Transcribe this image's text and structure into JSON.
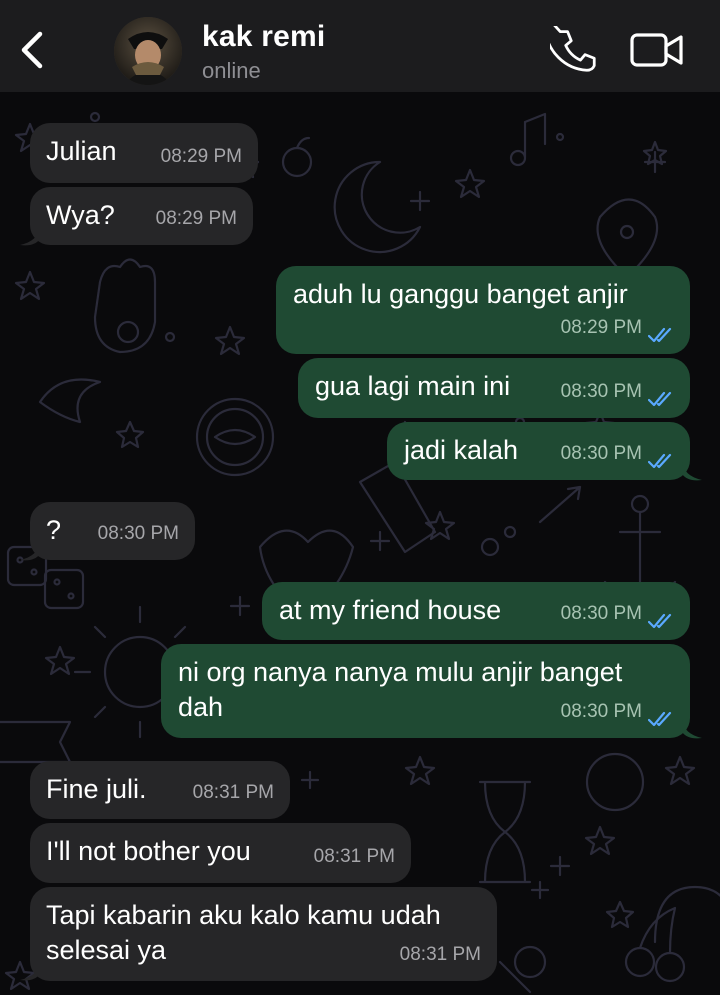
{
  "header": {
    "contact_name": "kak remi",
    "status": "online",
    "icons": {
      "back": "chevron-left-icon",
      "call": "phone-icon",
      "video": "video-camera-icon"
    }
  },
  "colors": {
    "header_bg": "#1c1c1e",
    "incoming_bubble": "#262628",
    "outgoing_bubble": "#1f4a33",
    "read_ticks": "#5aa9ff",
    "wallpaper_doodle": "#2a2a3a"
  },
  "messages": [
    {
      "direction": "in",
      "text": "Julian",
      "time": "08:29 PM"
    },
    {
      "direction": "in",
      "text": "Wya?",
      "time": "08:29 PM"
    },
    {
      "direction": "out",
      "text": "aduh lu ganggu banget anjir",
      "time": "08:29 PM",
      "read": true
    },
    {
      "direction": "out",
      "text": "gua lagi main ini",
      "time": "08:30 PM",
      "read": true
    },
    {
      "direction": "out",
      "text": "jadi kalah",
      "time": "08:30 PM",
      "read": true
    },
    {
      "direction": "in",
      "text": "?",
      "time": "08:30 PM"
    },
    {
      "direction": "out",
      "text": "at my friend house",
      "time": "08:30 PM",
      "read": true
    },
    {
      "direction": "out",
      "text_line1": "ni org nanya nanya mulu anjir banget",
      "text_line2": "dah",
      "time": "08:30 PM",
      "read": true
    },
    {
      "direction": "in",
      "text": "Fine juli.",
      "time": "08:31 PM"
    },
    {
      "direction": "in",
      "text": "I'll not bother you",
      "time": "08:31 PM"
    },
    {
      "direction": "in",
      "text_line1": "Tapi kabarin aku kalo kamu udah",
      "text_line2": "selesai ya",
      "time": "08:31 PM"
    }
  ]
}
